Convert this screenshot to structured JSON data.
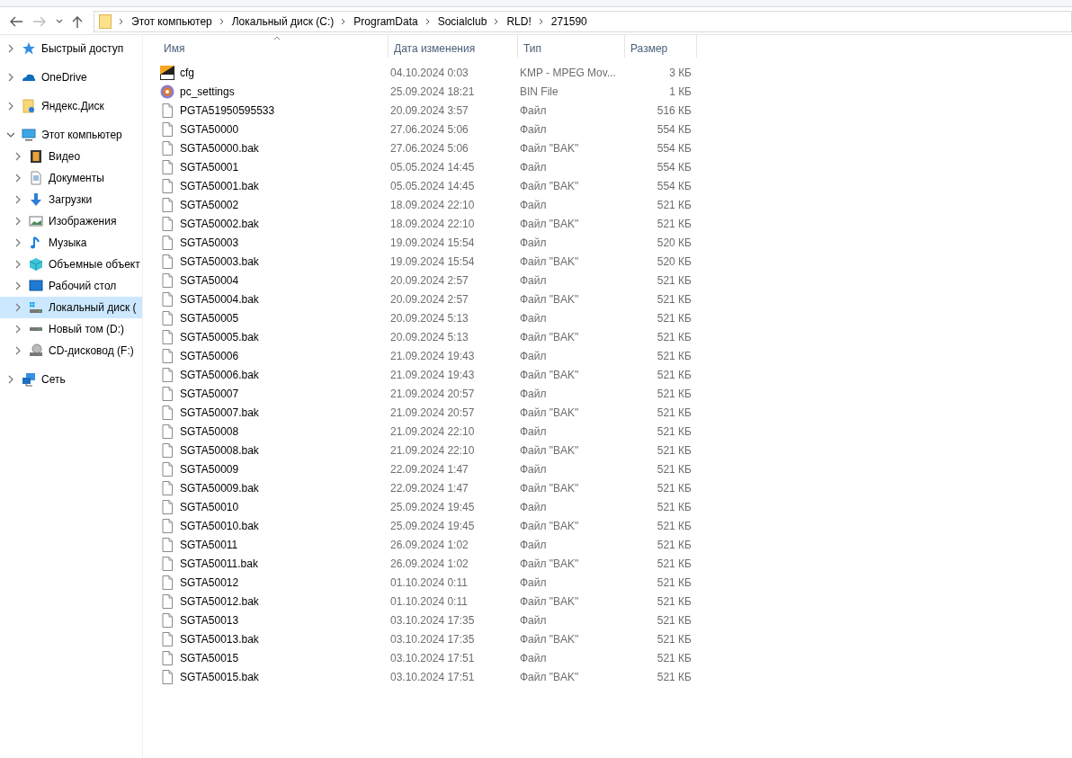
{
  "navigation": {
    "back_disabled": false,
    "forward_disabled": true
  },
  "breadcrumbs": [
    "Этот компьютер",
    "Локальный диск (C:)",
    "ProgramData",
    "Socialclub",
    "RLD!",
    "271590"
  ],
  "sidebar": {
    "items": [
      {
        "label": "Быстрый доступ",
        "kind": "star",
        "expanded": false,
        "selected": false
      },
      {
        "label": "OneDrive",
        "kind": "cloud",
        "expanded": false,
        "selected": false
      },
      {
        "label": "Яндекс.Диск",
        "kind": "yandex",
        "expanded": false,
        "selected": false
      },
      {
        "label": "Этот компьютер",
        "kind": "computer",
        "expanded": true,
        "selected": false,
        "children": [
          {
            "label": "Видео",
            "kind": "video",
            "expanded": false,
            "selected": false
          },
          {
            "label": "Документы",
            "kind": "documents",
            "expanded": false,
            "selected": false
          },
          {
            "label": "Загрузки",
            "kind": "downloads",
            "expanded": false,
            "selected": false
          },
          {
            "label": "Изображения",
            "kind": "images",
            "expanded": false,
            "selected": false
          },
          {
            "label": "Музыка",
            "kind": "music",
            "expanded": false,
            "selected": false
          },
          {
            "label": "Объемные объект",
            "kind": "objects",
            "expanded": false,
            "selected": false
          },
          {
            "label": "Рабочий стол",
            "kind": "desktop",
            "expanded": false,
            "selected": false
          },
          {
            "label": "Локальный диск (",
            "kind": "system-drive",
            "expanded": false,
            "selected": true
          },
          {
            "label": "Новый том (D:)",
            "kind": "drive",
            "expanded": false,
            "selected": false
          },
          {
            "label": "CD-дисковод (F:)",
            "kind": "cd",
            "expanded": false,
            "selected": false
          }
        ]
      },
      {
        "label": "Сеть",
        "kind": "network",
        "expanded": false,
        "selected": false
      }
    ]
  },
  "table": {
    "columns": [
      {
        "label": "Имя",
        "sorted": true
      },
      {
        "label": "Дата изменения",
        "sorted": false
      },
      {
        "label": "Тип",
        "sorted": false
      },
      {
        "label": "Размер",
        "sorted": false
      }
    ],
    "rows": [
      {
        "kind": "dat",
        "name": "cfg",
        "date": "04.10.2024 0:03",
        "type": "KMP - MPEG Mov...",
        "size": "3 КБ"
      },
      {
        "kind": "disc",
        "name": "pc_settings",
        "date": "25.09.2024 18:21",
        "type": "BIN File",
        "size": "1 КБ"
      },
      {
        "kind": "blank",
        "name": "PGTA51950595533",
        "date": "20.09.2024 3:57",
        "type": "Файл",
        "size": "516 КБ"
      },
      {
        "kind": "blank",
        "name": "SGTA50000",
        "date": "27.06.2024 5:06",
        "type": "Файл",
        "size": "554 КБ"
      },
      {
        "kind": "blank",
        "name": "SGTA50000.bak",
        "date": "27.06.2024 5:06",
        "type": "Файл \"BAK\"",
        "size": "554 КБ"
      },
      {
        "kind": "blank",
        "name": "SGTA50001",
        "date": "05.05.2024 14:45",
        "type": "Файл",
        "size": "554 КБ"
      },
      {
        "kind": "blank",
        "name": "SGTA50001.bak",
        "date": "05.05.2024 14:45",
        "type": "Файл \"BAK\"",
        "size": "554 КБ"
      },
      {
        "kind": "blank",
        "name": "SGTA50002",
        "date": "18.09.2024 22:10",
        "type": "Файл",
        "size": "521 КБ"
      },
      {
        "kind": "blank",
        "name": "SGTA50002.bak",
        "date": "18.09.2024 22:10",
        "type": "Файл \"BAK\"",
        "size": "521 КБ"
      },
      {
        "kind": "blank",
        "name": "SGTA50003",
        "date": "19.09.2024 15:54",
        "type": "Файл",
        "size": "520 КБ"
      },
      {
        "kind": "blank",
        "name": "SGTA50003.bak",
        "date": "19.09.2024 15:54",
        "type": "Файл \"BAK\"",
        "size": "520 КБ"
      },
      {
        "kind": "blank",
        "name": "SGTA50004",
        "date": "20.09.2024 2:57",
        "type": "Файл",
        "size": "521 КБ"
      },
      {
        "kind": "blank",
        "name": "SGTA50004.bak",
        "date": "20.09.2024 2:57",
        "type": "Файл \"BAK\"",
        "size": "521 КБ"
      },
      {
        "kind": "blank",
        "name": "SGTA50005",
        "date": "20.09.2024 5:13",
        "type": "Файл",
        "size": "521 КБ"
      },
      {
        "kind": "blank",
        "name": "SGTA50005.bak",
        "date": "20.09.2024 5:13",
        "type": "Файл \"BAK\"",
        "size": "521 КБ"
      },
      {
        "kind": "blank",
        "name": "SGTA50006",
        "date": "21.09.2024 19:43",
        "type": "Файл",
        "size": "521 КБ"
      },
      {
        "kind": "blank",
        "name": "SGTA50006.bak",
        "date": "21.09.2024 19:43",
        "type": "Файл \"BAK\"",
        "size": "521 КБ"
      },
      {
        "kind": "blank",
        "name": "SGTA50007",
        "date": "21.09.2024 20:57",
        "type": "Файл",
        "size": "521 КБ"
      },
      {
        "kind": "blank",
        "name": "SGTA50007.bak",
        "date": "21.09.2024 20:57",
        "type": "Файл \"BAK\"",
        "size": "521 КБ"
      },
      {
        "kind": "blank",
        "name": "SGTA50008",
        "date": "21.09.2024 22:10",
        "type": "Файл",
        "size": "521 КБ"
      },
      {
        "kind": "blank",
        "name": "SGTA50008.bak",
        "date": "21.09.2024 22:10",
        "type": "Файл \"BAK\"",
        "size": "521 КБ"
      },
      {
        "kind": "blank",
        "name": "SGTA50009",
        "date": "22.09.2024 1:47",
        "type": "Файл",
        "size": "521 КБ"
      },
      {
        "kind": "blank",
        "name": "SGTA50009.bak",
        "date": "22.09.2024 1:47",
        "type": "Файл \"BAK\"",
        "size": "521 КБ"
      },
      {
        "kind": "blank",
        "name": "SGTA50010",
        "date": "25.09.2024 19:45",
        "type": "Файл",
        "size": "521 КБ"
      },
      {
        "kind": "blank",
        "name": "SGTA50010.bak",
        "date": "25.09.2024 19:45",
        "type": "Файл \"BAK\"",
        "size": "521 КБ"
      },
      {
        "kind": "blank",
        "name": "SGTA50011",
        "date": "26.09.2024 1:02",
        "type": "Файл",
        "size": "521 КБ"
      },
      {
        "kind": "blank",
        "name": "SGTA50011.bak",
        "date": "26.09.2024 1:02",
        "type": "Файл \"BAK\"",
        "size": "521 КБ"
      },
      {
        "kind": "blank",
        "name": "SGTA50012",
        "date": "01.10.2024 0:11",
        "type": "Файл",
        "size": "521 КБ"
      },
      {
        "kind": "blank",
        "name": "SGTA50012.bak",
        "date": "01.10.2024 0:11",
        "type": "Файл \"BAK\"",
        "size": "521 КБ"
      },
      {
        "kind": "blank",
        "name": "SGTA50013",
        "date": "03.10.2024 17:35",
        "type": "Файл",
        "size": "521 КБ"
      },
      {
        "kind": "blank",
        "name": "SGTA50013.bak",
        "date": "03.10.2024 17:35",
        "type": "Файл \"BAK\"",
        "size": "521 КБ"
      },
      {
        "kind": "blank",
        "name": "SGTA50015",
        "date": "03.10.2024 17:51",
        "type": "Файл",
        "size": "521 КБ"
      },
      {
        "kind": "blank",
        "name": "SGTA50015.bak",
        "date": "03.10.2024 17:51",
        "type": "Файл \"BAK\"",
        "size": "521 КБ"
      }
    ]
  }
}
